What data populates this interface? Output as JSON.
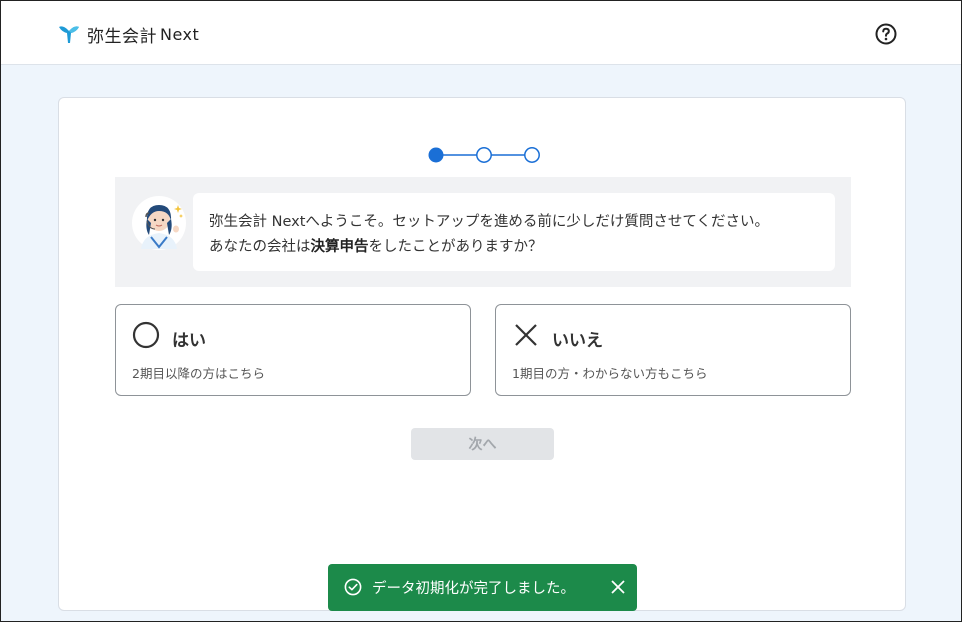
{
  "header": {
    "app_name": "弥生会計",
    "app_suffix": "Next",
    "help_icon": "help-circle-icon"
  },
  "stepper": {
    "total_steps": 3,
    "current_step": 1,
    "active_color": "#1a6fd6"
  },
  "message": {
    "avatar_icon": "support-agent-avatar",
    "line1": "弥生会計 Nextへようこそ。セットアップを進める前に少しだけ質問させてください。",
    "line2_before": "あなたの会社は",
    "line2_bold": "決算申告",
    "line2_after": "をしたことがありますか？"
  },
  "options": {
    "yes": {
      "icon": "circle-icon",
      "title": "はい",
      "subtitle": "2期目以降の方はこちら"
    },
    "no": {
      "icon": "cross-icon",
      "title": "いいえ",
      "subtitle": "1期目の方・わからない方もこちら"
    }
  },
  "next_button": {
    "label": "次へ"
  },
  "toast": {
    "icon": "check-circle-icon",
    "message": "データ初期化が完了しました。",
    "close_icon": "close-icon",
    "color": "#1c8a4a"
  }
}
